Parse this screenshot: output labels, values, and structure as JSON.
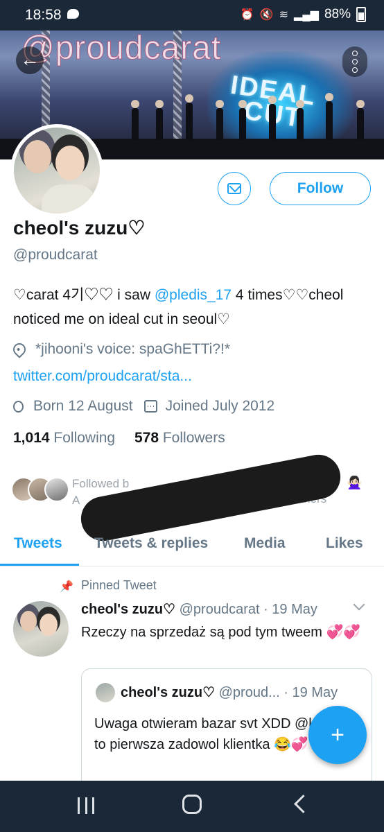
{
  "status_bar": {
    "time": "18:58",
    "battery": "88%"
  },
  "banner": {
    "watermark": "@proudcarat",
    "screen_text_1": "IDEAL",
    "screen_text_2": "CUT"
  },
  "header": {
    "back_glyph": "←"
  },
  "profile": {
    "display_name": "cheol's zuzu♡",
    "handle": "@proudcarat",
    "follow_label": "Follow",
    "bio_pre": "♡carat 4기♡♡ i saw ",
    "bio_mention": "@pledis_17",
    "bio_post": " 4 times♡♡cheol noticed me on ideal cut in seoul♡",
    "location": "*jihooni's voice: spaGhETTi?!*",
    "website": "twitter.com/proudcarat/sta...",
    "born": "Born 12 August",
    "joined": "Joined July 2012",
    "following_count": "1,014",
    "following_label": "Following",
    "followers_count": "578",
    "followers_label": "Followers",
    "followed_by_start": "Followed b",
    "followed_by_line2": "A",
    "followed_by_end": "others"
  },
  "tabs": [
    {
      "label": "Tweets"
    },
    {
      "label": "Tweets & replies"
    },
    {
      "label": "Media"
    },
    {
      "label": "Likes"
    }
  ],
  "pinned_tweet": {
    "pinned_label": "Pinned Tweet",
    "author_name": "cheol's zuzu♡",
    "author_handle": "@proudcarat",
    "date": "· 19 May",
    "text": "Rzeczy na sprzedaż są pod tym tweem 💞💞",
    "quote": {
      "author_name": "cheol's zuzu♡",
      "author_handle": "@proud...",
      "date": "· 19 May",
      "text": "Uwaga otwieram bazar svt XDD @lovejkjh to pierwsza zadowol klientka 😂💞"
    }
  },
  "fab": {
    "glyph": "+"
  },
  "colors": {
    "accent": "#1da1f2",
    "muted": "#657786",
    "system_bar": "#1b2838"
  }
}
